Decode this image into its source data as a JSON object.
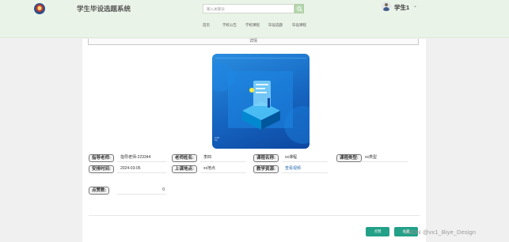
{
  "header": {
    "site_title": "学生毕设选题系统",
    "search_placeholder": "输入关键词",
    "user_name": "学生1",
    "user_caret": "⌄"
  },
  "nav": {
    "items": [
      {
        "label": "首页"
      },
      {
        "label": "学校公告"
      },
      {
        "label": "学校课程"
      },
      {
        "label": "毕设选题"
      },
      {
        "label": "毕设课程"
      }
    ]
  },
  "main": {
    "top_tab_label": "详情",
    "cover_caption_line1": "smart",
    "cover_caption_line2": "city"
  },
  "fields": [
    {
      "label": "指导老师:",
      "value": "指导老师-223344"
    },
    {
      "label": "老师姓名:",
      "value": "李四"
    },
    {
      "label": "课程名称:",
      "value": "xx课程"
    },
    {
      "label": "课程类型:",
      "value": "xx类型"
    },
    {
      "label": "安排时间:",
      "value": "2024-03-05"
    },
    {
      "label": "上课地点:",
      "value": "xx地点"
    },
    {
      "label": "教学资源:",
      "value": "查看视频"
    },
    {
      "label": "点赞数:",
      "value": "0"
    }
  ],
  "actions": {
    "like_label": "点赞",
    "collect_label": "收藏"
  },
  "watermark": "CSDN @vx1_Biye_Design",
  "colors": {
    "header_bg": "#eaf3e7",
    "button_bg": "#23a088",
    "cover_blue": "#1565c0"
  }
}
